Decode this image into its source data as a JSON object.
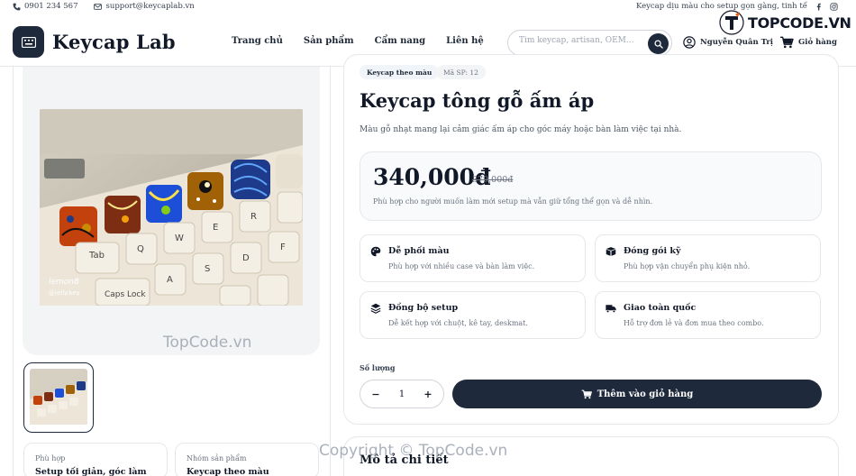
{
  "topbar": {
    "phone": "0901 234 567",
    "email": "support@keycaplab.vn",
    "tagline": "Keycap dịu màu cho setup gọn gàng, tinh tế"
  },
  "header": {
    "logo_text": "Keycap Lab",
    "nav": [
      "Trang chủ",
      "Sản phẩm",
      "Cẩm nang",
      "Liên hệ"
    ],
    "search_placeholder": "Tìm keycap, artisan, OEM...",
    "user_name": "Nguyễn Quân Trị",
    "cart_label": "Giỏ hàng"
  },
  "product": {
    "chip_category": "Keycap theo màu",
    "chip_sku": "Mã SP: 12",
    "title": "Keycap tông gỗ ấm áp",
    "description": "Màu gỗ nhạt mang lại cảm giác ấm áp cho góc máy hoặc bàn làm việc tại nhà.",
    "price": "340,000đ",
    "old_price": "379,000đ",
    "price_note": "Phù hợp cho người muốn làm mới setup mà vẫn giữ tổng thể gọn và dễ nhìn.",
    "features": [
      {
        "icon": "palette-icon",
        "title": "Dễ phối màu",
        "desc": "Phù hợp với nhiều case và bàn làm việc."
      },
      {
        "icon": "box-icon",
        "title": "Đóng gói kỹ",
        "desc": "Phù hợp vận chuyển phụ kiện nhỏ."
      },
      {
        "icon": "layers-icon",
        "title": "Đồng bộ setup",
        "desc": "Dễ kết hợp với chuột, kê tay, deskmat."
      },
      {
        "icon": "truck-icon",
        "title": "Giao toàn quốc",
        "desc": "Hỗ trợ đơn lẻ và đơn mua theo combo."
      }
    ],
    "qty_label": "Số lượng",
    "qty_value": "1",
    "qty_minus": "−",
    "qty_plus": "+",
    "add_to_cart": "Thêm vào giỏ hàng"
  },
  "gallery": {
    "photo_watermark": "lemon8",
    "photo_handle": "@jelly.key"
  },
  "info_cards": [
    {
      "label": "Phù hợp",
      "value": "Setup tối giản, góc làm việc"
    },
    {
      "label": "Nhóm sản phẩm",
      "value": "Keycap theo màu"
    }
  ],
  "description_section": {
    "title": "Mô tả chi tiết"
  },
  "watermarks": {
    "brand": "TOPCODE.VN",
    "mid": "TopCode.vn",
    "bottom": "Copyright © TopCode.vn"
  },
  "colors": {
    "primary": "#1e293b",
    "border": "#e5e7eb",
    "muted": "#6b7280"
  }
}
